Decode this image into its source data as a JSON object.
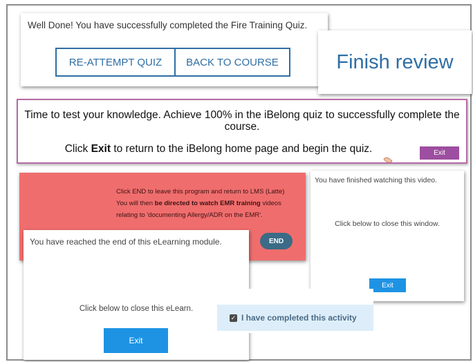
{
  "fire_quiz": {
    "message": "Well Done! You have successfully completed the Fire Training Quiz.",
    "reattempt_label": "RE-ATTEMPT QUIZ",
    "back_label": "BACK TO COURSE"
  },
  "finish_review": {
    "label": "Finish review"
  },
  "ibelong": {
    "line1": "Time to test your knowledge. Achieve 100% in the iBelong quiz to successfully complete the course.",
    "line2_prefix": "Click ",
    "line2_bold": "Exit",
    "line2_suffix": " to return to the iBelong home page and begin the quiz.",
    "exit_label": "Exit"
  },
  "lms": {
    "line1": "Click END to leave this program and return to LMS (Latte)",
    "line2_prefix": "You will then ",
    "line2_bold": "be directed to watch EMR training",
    "line2_suffix": " videos",
    "line3": "relating to 'documenting Allergy/ADR on the EMR'.",
    "end_label": "END",
    "colors": {
      "background": "#f06d6d",
      "button": "#3b6b86"
    }
  },
  "video": {
    "finished": "You have finished watching this video.",
    "instruction": "Click below to close this window.",
    "exit_label": "Exit"
  },
  "elearning": {
    "finished": "You have reached the end of this eLearning module.",
    "instruction": "Click below to close this eLearn.",
    "exit_label": "Exit"
  },
  "activity": {
    "label": "I have completed this activity",
    "checked": true
  },
  "icons": {
    "checkbox": "checkbox-checked-icon",
    "cursor": "hand-cursor-icon"
  }
}
